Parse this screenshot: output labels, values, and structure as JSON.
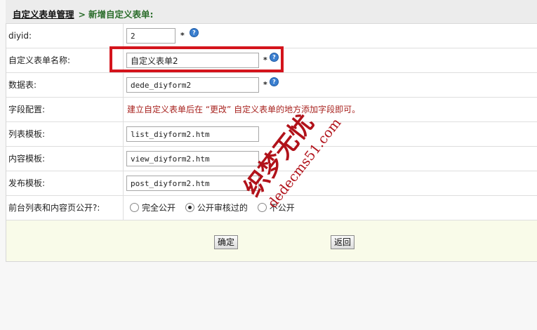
{
  "header": {
    "breadcrumb_parent": "自定义表单管理",
    "breadcrumb_sep": ">",
    "breadcrumb_current": "新增自定义表单:"
  },
  "form": {
    "diyid": {
      "label": "diyid:",
      "value": "2"
    },
    "name": {
      "label": "自定义表单名称:",
      "value": "自定义表单2"
    },
    "table": {
      "label": "数据表:",
      "value": "dede_diyform2"
    },
    "fields": {
      "label": "字段配置:",
      "note": "建立自定义表单后在 “更改” 自定义表单的地方添加字段即可。"
    },
    "list_tpl": {
      "label": "列表模板:",
      "value": "list_diyform2.htm"
    },
    "view_tpl": {
      "label": "内容模板:",
      "value": "view_diyform2.htm"
    },
    "post_tpl": {
      "label": "发布模板:",
      "value": "post_diyform2.htm"
    },
    "public": {
      "label": "前台列表和内容页公开?:",
      "options": [
        "完全公开",
        "公开审核过的",
        "不公开"
      ],
      "selected": "公开审核过的"
    },
    "required_mark": "*",
    "help_mark": "?"
  },
  "buttons": {
    "ok": "确定",
    "back": "返回"
  },
  "watermark": {
    "line1": "织梦无忧",
    "line2": "dedecms51.com"
  },
  "colors": {
    "note": "#a8231f",
    "highlight": "#d4141c",
    "crumb": "#2b6d2b",
    "footer_bg": "#f9fbe9"
  }
}
